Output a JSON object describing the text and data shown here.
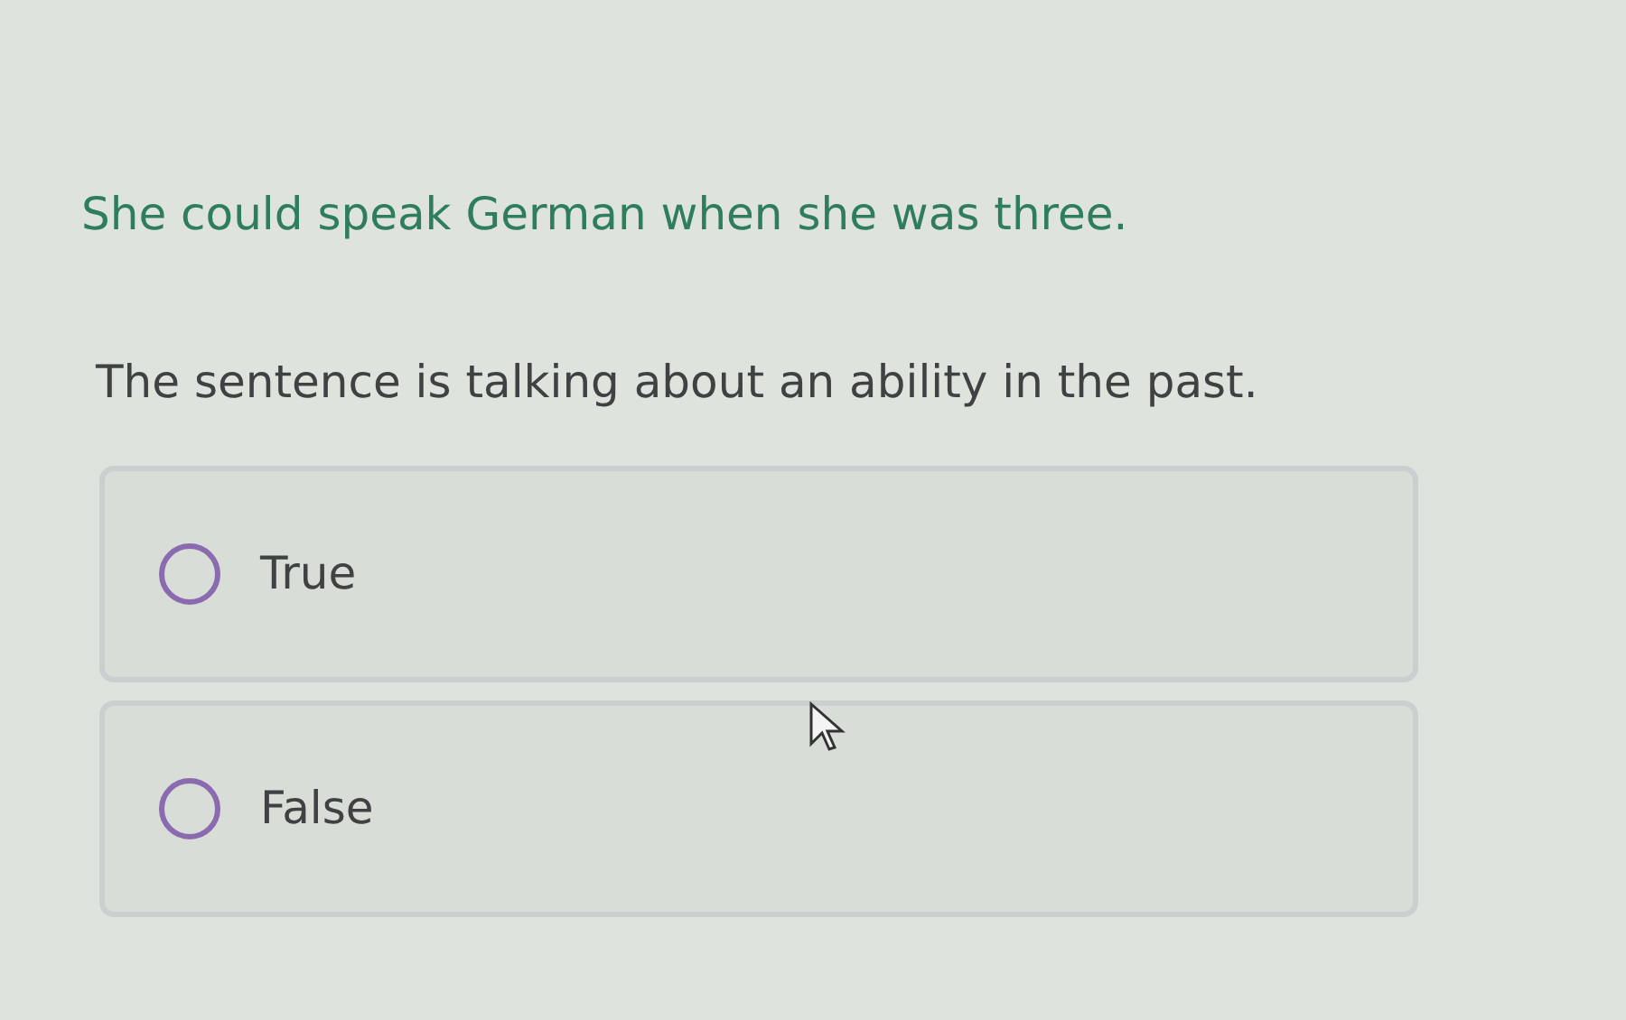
{
  "question": {
    "sentence": "She could speak German when she was three.",
    "prompt": "The sentence is talking about an ability in the past."
  },
  "options": [
    {
      "label": "True",
      "selected": false
    },
    {
      "label": "False",
      "selected": false
    }
  ]
}
